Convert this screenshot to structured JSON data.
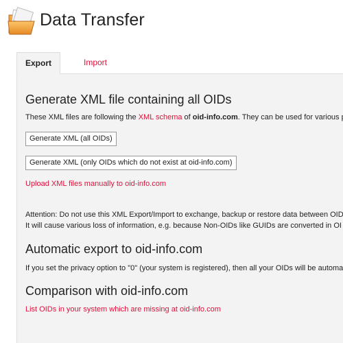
{
  "app": {
    "title": "Data Transfer",
    "icon": "folder-icon"
  },
  "tabs": [
    {
      "label": "Export",
      "active": true
    },
    {
      "label": "Import",
      "active": false
    }
  ],
  "export": {
    "heading": "Generate XML file containing all OIDs",
    "desc_prefix": "These XML files are following the ",
    "desc_link": "XML schema",
    "desc_mid": " of ",
    "desc_bold": "oid-info.com",
    "desc_suffix": ". They can be used for various p",
    "button_all": "Generate XML (all OIDs)",
    "button_missing": "Generate XML (only OIDs which do not exist at oid-info.com)",
    "upload_link": "Upload XML files manually to oid-info.com",
    "attention_line1": "Attention: Do not use this XML Export/Import to exchange, backup or restore data between OID",
    "attention_line2": "It will cause various loss of information, e.g. because Non-OIDs like GUIDs are converted in OI",
    "auto_heading": "Automatic export to oid-info.com",
    "auto_text": "If you set the privacy option to \"0\" (your system is registered), then all your OIDs will be automa",
    "compare_heading": "Comparison with oid-info.com",
    "compare_link": "List OIDs in your system which are missing at oid-info.com"
  },
  "colors": {
    "accent": "#e0103a",
    "panel_bg": "#f3f3f3",
    "text": "#222222",
    "border": "#dddddd"
  }
}
